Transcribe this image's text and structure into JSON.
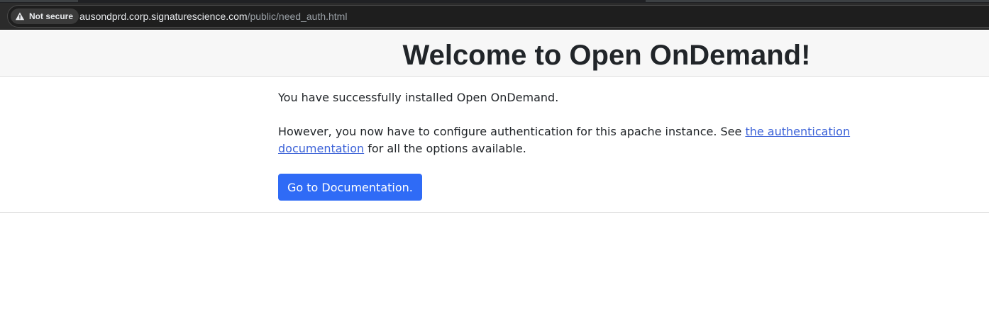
{
  "browser": {
    "security_label": "Not secure",
    "url_host": "ausondprd.corp.signaturescience.com",
    "url_path": "/public/need_auth.html",
    "icon": "warning-triangle-icon"
  },
  "page": {
    "title": "Welcome to Open OnDemand!",
    "intro": "You have successfully installed Open OnDemand.",
    "config_before": "However, you now have to configure authentication for this apache instance. See ",
    "config_link": "the authentication documentation",
    "config_after": " for all the options available.",
    "button_label": "Go to Documentation."
  },
  "colors": {
    "link": "#3d63d8",
    "button": "#2f6bf6",
    "header_band": "#f7f7f7"
  }
}
